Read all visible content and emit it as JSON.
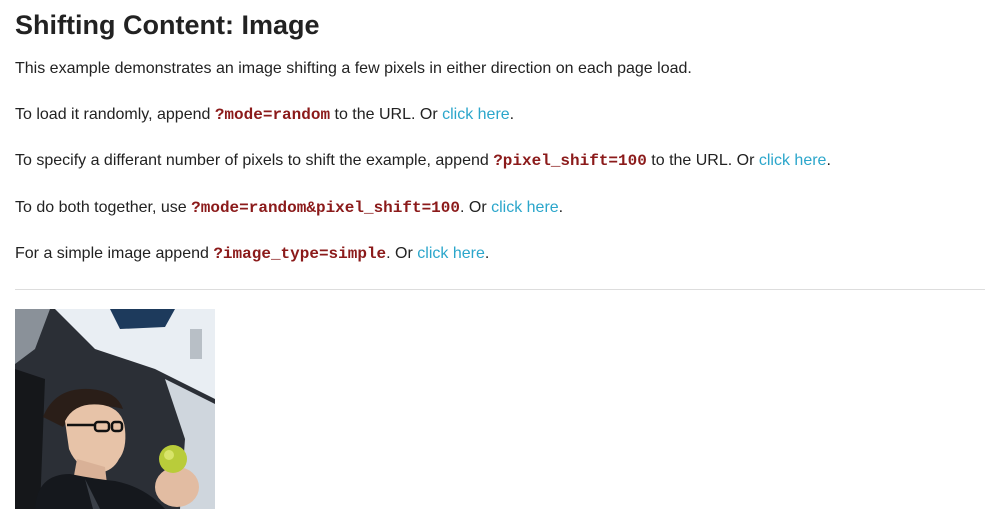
{
  "page": {
    "title": "Shifting Content: Image"
  },
  "intro": {
    "text": "This example demonstrates an image shifting a few pixels in either direction on each page load."
  },
  "random": {
    "prefix": "To load it randomly, append ",
    "code": "?mode=random",
    "middle": " to the URL. Or ",
    "link": "click here",
    "suffix": "."
  },
  "pixel_shift": {
    "prefix": "To specify a differant number of pixels to shift the example, append ",
    "code": "?pixel_shift=100",
    "middle": " to the URL. Or ",
    "link": "click here",
    "suffix": "."
  },
  "both": {
    "prefix": "To do both together, use ",
    "code": "?mode=random&pixel_shift=100",
    "middle": ". Or ",
    "link": "click here",
    "suffix": "."
  },
  "simple": {
    "prefix": "For a simple image append ",
    "code": "?image_type=simple",
    "middle": ". Or ",
    "link": "click here",
    "suffix": "."
  },
  "colors": {
    "text": "#222222",
    "link": "#2ba6cb",
    "code": "#8b1a1a",
    "divider": "#dddddd"
  },
  "image": {
    "icon": "photo-person-in-car-eating-apple"
  }
}
